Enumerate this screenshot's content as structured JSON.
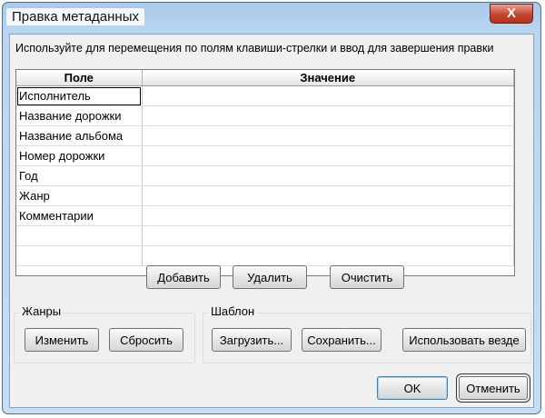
{
  "window": {
    "title": "Правка метаданных",
    "close_glyph": "X"
  },
  "instruction": "Используйте для перемещения по полям клавиши-стрелки и ввод для завершения правки",
  "grid": {
    "columns": [
      "Поле",
      "Значение"
    ],
    "rows": [
      {
        "field": "Исполнитель",
        "value": ""
      },
      {
        "field": "Название дорожки",
        "value": ""
      },
      {
        "field": "Название альбома",
        "value": ""
      },
      {
        "field": "Номер дорожки",
        "value": ""
      },
      {
        "field": "Год",
        "value": ""
      },
      {
        "field": "Жанр",
        "value": ""
      },
      {
        "field": "Комментарии",
        "value": ""
      },
      {
        "field": "",
        "value": ""
      },
      {
        "field": "",
        "value": ""
      }
    ]
  },
  "actions": {
    "add": "Добавить",
    "delete": "Удалить",
    "clear": "Очистить"
  },
  "genres": {
    "label": "Жанры",
    "change": "Изменить",
    "reset": "Сбросить"
  },
  "template": {
    "label": "Шаблон",
    "load": "Загрузить...",
    "save": "Сохранить...",
    "use_everywhere": "Использовать везде"
  },
  "dialog": {
    "ok": "OK",
    "cancel": "Отменить"
  }
}
